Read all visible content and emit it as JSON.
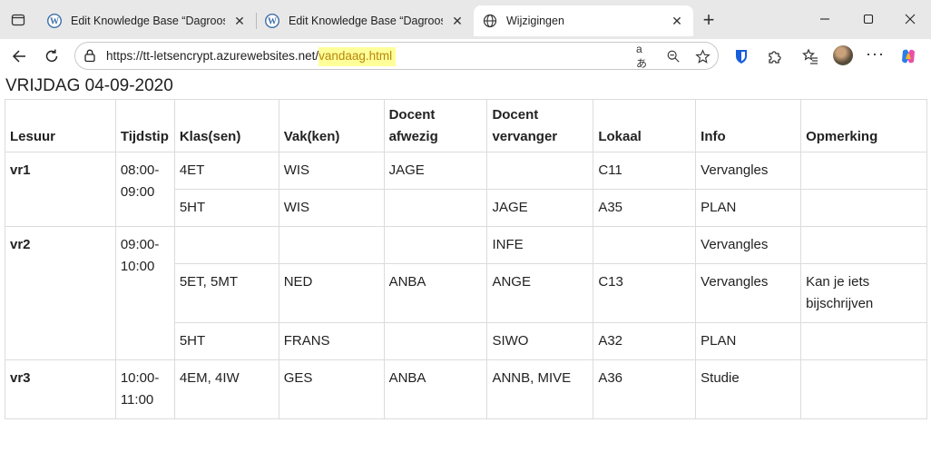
{
  "browser": {
    "tabs": [
      {
        "title": "Edit Knowledge Base “Dagrooster",
        "icon": "wordpress-icon",
        "active": false
      },
      {
        "title": "Edit Knowledge Base “Dagrooster",
        "icon": "wordpress-icon",
        "active": false
      },
      {
        "title": "Wijzigingen",
        "icon": "globe-icon",
        "active": true
      }
    ],
    "url_base": "https://tt-letsencrypt.azurewebsites.net/",
    "url_path": "vandaag.html"
  },
  "page": {
    "date_title": "VRIJDAG 04-09-2020",
    "headers": [
      "Lesuur",
      "Tijdstip",
      "Klas(sen)",
      "Vak(ken)",
      "Docent afwezig",
      "Docent vervanger",
      "Lokaal",
      "Info",
      "Opmerking"
    ],
    "groups": [
      {
        "lesuur": "vr1",
        "tijdstip": "08:00-09:00",
        "rows": [
          {
            "klas": "4ET",
            "vak": "WIS",
            "afwezig": "JAGE",
            "vervanger": "",
            "lokaal": "C11",
            "info": "Vervangles",
            "opmerking": ""
          },
          {
            "klas": "5HT",
            "vak": "WIS",
            "afwezig": "",
            "vervanger": "JAGE",
            "lokaal": "A35",
            "info": "PLAN",
            "opmerking": ""
          }
        ]
      },
      {
        "lesuur": "vr2",
        "tijdstip": "09:00-10:00",
        "rows": [
          {
            "klas": "",
            "vak": "",
            "afwezig": "",
            "vervanger": "INFE",
            "lokaal": "",
            "info": "Vervangles",
            "opmerking": ""
          },
          {
            "klas": "5ET, 5MT",
            "vak": "NED",
            "afwezig": "ANBA",
            "vervanger": "ANGE",
            "lokaal": "C13",
            "info": "Vervangles",
            "opmerking": "Kan je iets bijschrijven"
          },
          {
            "klas": "5HT",
            "vak": "FRANS",
            "afwezig": "",
            "vervanger": "SIWO",
            "lokaal": "A32",
            "info": "PLAN",
            "opmerking": ""
          }
        ]
      },
      {
        "lesuur": "vr3",
        "tijdstip": "10:00-11:00",
        "rows": [
          {
            "klas": "4EM, 4IW",
            "vak": "GES",
            "afwezig": "ANBA",
            "vervanger": "ANNB, MIVE",
            "lokaal": "A36",
            "info": "Studie",
            "opmerking": ""
          }
        ]
      }
    ]
  }
}
